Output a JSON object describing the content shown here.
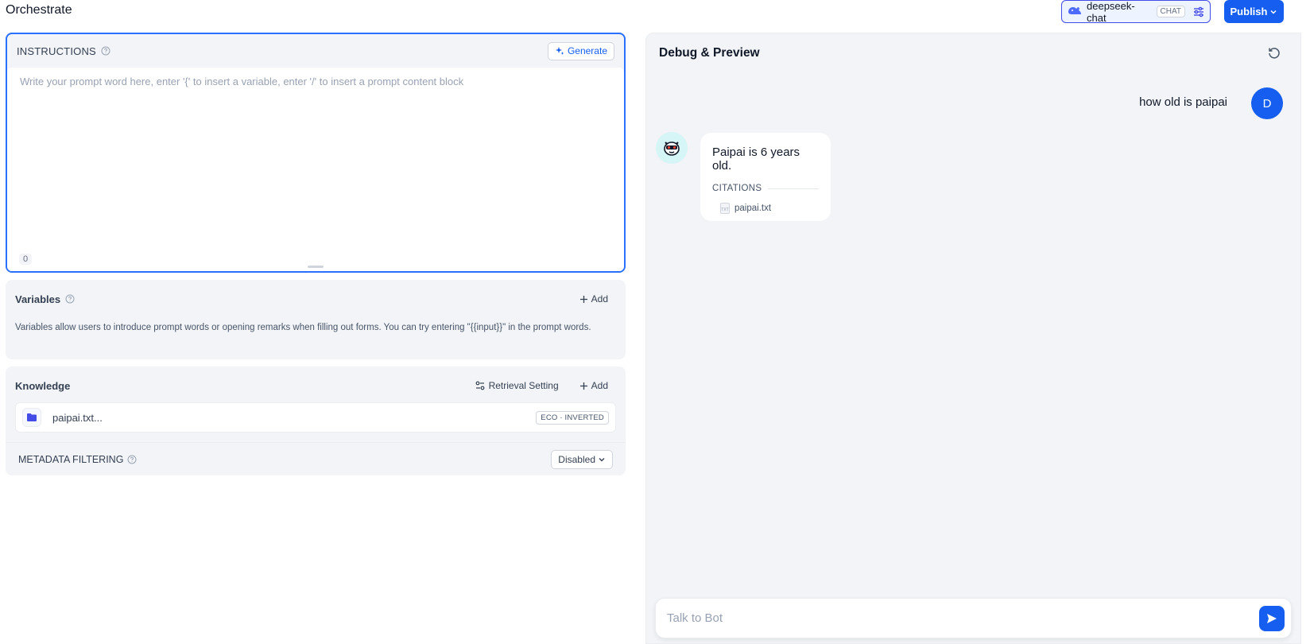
{
  "header": {
    "title": "Orchestrate",
    "model": {
      "name": "deepseek-chat",
      "mode_badge": "CHAT",
      "icon": "whale-icon"
    },
    "publish_label": "Publish"
  },
  "instructions": {
    "label": "INSTRUCTIONS",
    "generate_label": "Generate",
    "placeholder": "Write your prompt word here, enter '{' to insert a variable, enter '/' to insert a prompt content block",
    "value": "",
    "char_count": "0"
  },
  "variables": {
    "title": "Variables",
    "add_label": "Add",
    "description": "Variables allow users to introduce prompt words or opening remarks when filling out forms. You can try entering \"{{input}}\" in the prompt words."
  },
  "knowledge": {
    "title": "Knowledge",
    "retrieval_label": "Retrieval Setting",
    "add_label": "Add",
    "datasets": [
      {
        "name": "paipai.txt...",
        "badge": "ECO · INVERTED"
      }
    ],
    "metadata_filtering": {
      "label": "METADATA FILTERING",
      "value": "Disabled"
    }
  },
  "debug": {
    "title": "Debug & Preview",
    "user_message": "how old is paipai",
    "user_avatar_letter": "D",
    "bot_message": "Paipai is 6 years old.",
    "citations_label": "CITATIONS",
    "citations": [
      {
        "name": "paipai.txt",
        "type": "txt"
      }
    ],
    "input_placeholder": "Talk to Bot"
  },
  "colors": {
    "accent": "#155eef",
    "focus_border": "#2970ff",
    "panel_bg": "#f2f4f7",
    "model_border": "#444ce7"
  }
}
